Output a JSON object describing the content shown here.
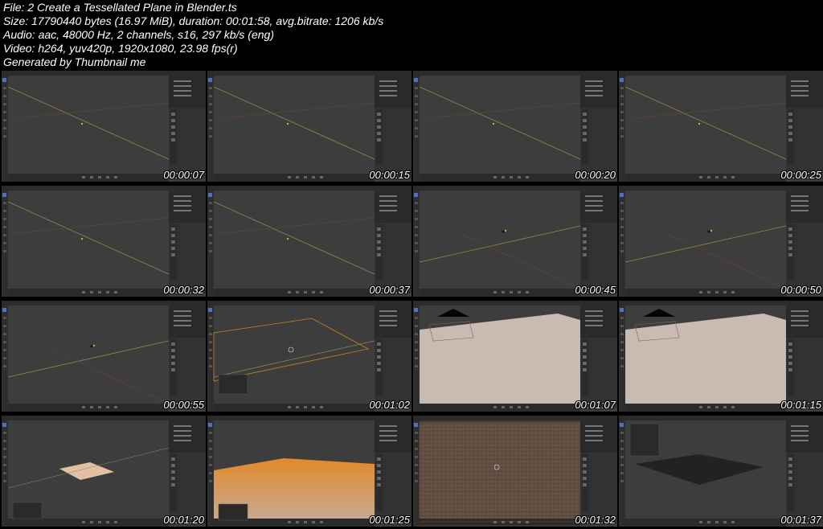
{
  "header": {
    "file": "File: 2 Create a Tessellated Plane in Blender.ts",
    "size": "Size: 17790440 bytes (16.97 MiB), duration: 00:01:58, avg.bitrate: 1206 kb/s",
    "audio": "Audio: aac, 48000 Hz, 2 channels, s16, 297 kb/s (eng)",
    "video": "Video: h264, yuv420p, 1920x1080, 23.98 fps(r)",
    "generator": "Generated by Thumbnail me"
  },
  "thumbnails": [
    {
      "time": "00:00:07",
      "scene": "empty"
    },
    {
      "time": "00:00:15",
      "scene": "empty"
    },
    {
      "time": "00:00:20",
      "scene": "empty"
    },
    {
      "time": "00:00:25",
      "scene": "empty"
    },
    {
      "time": "00:00:32",
      "scene": "empty"
    },
    {
      "time": "00:00:37",
      "scene": "empty"
    },
    {
      "time": "00:00:45",
      "scene": "view"
    },
    {
      "time": "00:00:50",
      "scene": "view"
    },
    {
      "time": "00:00:55",
      "scene": "view"
    },
    {
      "time": "00:01:02",
      "scene": "outline"
    },
    {
      "time": "00:01:07",
      "scene": "closeup"
    },
    {
      "time": "00:01:15",
      "scene": "closeup"
    },
    {
      "time": "00:01:20",
      "scene": "smallplane"
    },
    {
      "time": "00:01:25",
      "scene": "orange"
    },
    {
      "time": "00:01:32",
      "scene": "grid"
    },
    {
      "time": "00:01:37",
      "scene": "darkplane"
    }
  ]
}
